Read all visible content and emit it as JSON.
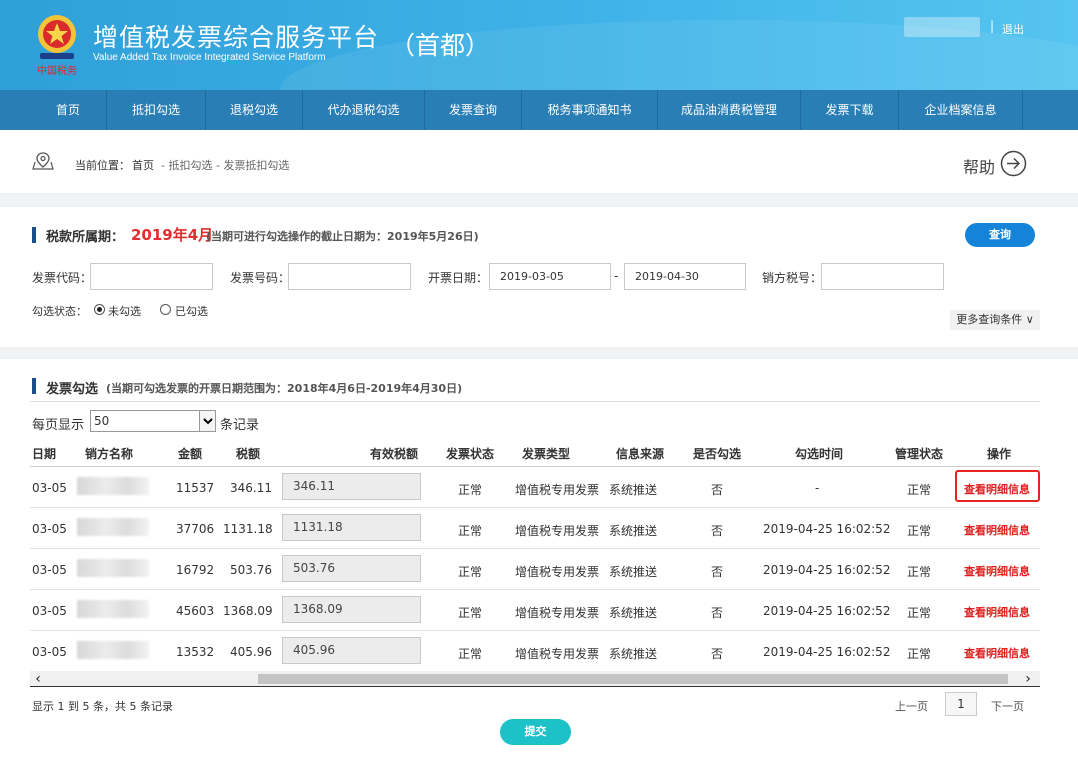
{
  "header": {
    "title_cn": "增值税发票综合服务平台",
    "title_en": "Value Added Tax Invoice Integrated Service Platform",
    "region": "（首都）",
    "separator": "|",
    "logout": "退出"
  },
  "nav": {
    "tabs": [
      "首页",
      "抵扣勾选",
      "退税勾选",
      "代办退税勾选",
      "发票查询",
      "税务事项通知书",
      "成品油消费税管理",
      "发票下载",
      "企业档案信息"
    ]
  },
  "breadcrumb": {
    "label": "当前位置：",
    "home": "首页",
    "rest": " - 抵扣勾选 - 发票抵扣勾选",
    "help": "帮助"
  },
  "query": {
    "period_label": "税款所属期：",
    "period_value": "2019年4月",
    "period_note": "(当期可进行勾选操作的截止日期为：2019年5月26日)",
    "search_button": "查询",
    "invoice_code_label": "发票代码：",
    "invoice_code_value": "",
    "invoice_number_label": "发票号码：",
    "invoice_number_value": "",
    "date_label": "开票日期：",
    "date_from": "2019-03-05",
    "date_separator": "-",
    "date_to": "2019-04-30",
    "seller_tax_label": "销方税号：",
    "seller_tax_value": "",
    "status_label": "勾选状态：",
    "status_unchecked": "未勾选",
    "status_checked": "已勾选",
    "more_conditions": "更多查询条件 ∨"
  },
  "invoices": {
    "title": "发票勾选",
    "note": "(当期可勾选发票的开票日期范围为：2018年4月6日-2019年4月30日)",
    "per_page_label": "每页显示",
    "per_page_value": "50",
    "per_page_suffix": "条记录",
    "columns": [
      "日期",
      "销方名称",
      "金额",
      "税额",
      "有效税额",
      "发票状态",
      "发票类型",
      "信息来源",
      "是否勾选",
      "勾选时间",
      "管理状态",
      "操作"
    ],
    "rows": [
      {
        "date": "03-05",
        "amount": "11537",
        "tax": "346.11",
        "effective_tax": "346.11",
        "status": "正常",
        "type": "增值税专用发票",
        "source": "系统推送",
        "selected": "否",
        "select_time": "-",
        "manage_status": "正常",
        "action": "查看明细信息"
      },
      {
        "date": "03-05",
        "amount": "37706",
        "tax": "1131.18",
        "effective_tax": "1131.18",
        "status": "正常",
        "type": "增值税专用发票",
        "source": "系统推送",
        "selected": "否",
        "select_time": "2019-04-25 16:02:52",
        "manage_status": "正常",
        "action": "查看明细信息"
      },
      {
        "date": "03-05",
        "amount": "16792",
        "tax": "503.76",
        "effective_tax": "503.76",
        "status": "正常",
        "type": "增值税专用发票",
        "source": "系统推送",
        "selected": "否",
        "select_time": "2019-04-25 16:02:52",
        "manage_status": "正常",
        "action": "查看明细信息"
      },
      {
        "date": "03-05",
        "amount": "45603",
        "tax": "1368.09",
        "effective_tax": "1368.09",
        "status": "正常",
        "type": "增值税专用发票",
        "source": "系统推送",
        "selected": "否",
        "select_time": "2019-04-25 16:02:52",
        "manage_status": "正常",
        "action": "查看明细信息"
      },
      {
        "date": "03-05",
        "amount": "13532",
        "tax": "405.96",
        "effective_tax": "405.96",
        "status": "正常",
        "type": "增值税专用发票",
        "source": "系统推送",
        "selected": "否",
        "select_time": "2019-04-25 16:02:52",
        "manage_status": "正常",
        "action": "查看明细信息"
      }
    ],
    "summary": "显示 1 到 5 条，共 5 条记录",
    "prev_page": "上一页",
    "current_page": "1",
    "next_page": "下一页",
    "submit": "提交"
  },
  "colors": {
    "header_blue": "#3fb3e8",
    "nav_blue": "#2a7eb6",
    "accent_red": "#e02d2d",
    "query_button": "#1584d8",
    "submit_button": "#1cc2c8"
  }
}
